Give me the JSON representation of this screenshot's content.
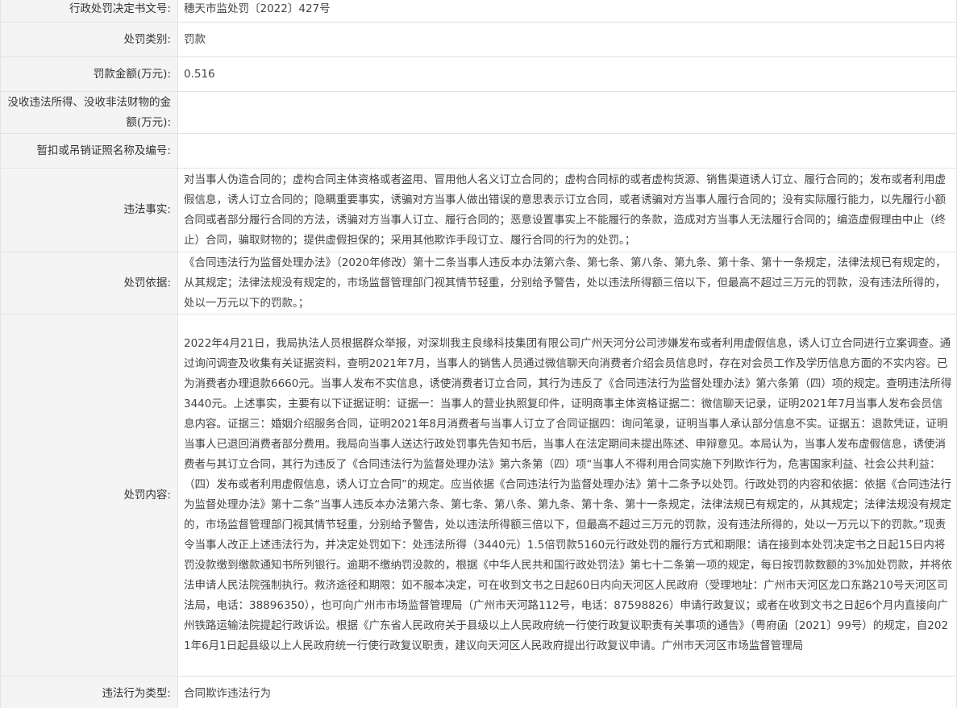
{
  "rows": [
    {
      "label": "行政处罚决定书文号:",
      "value": "穗天市监处罚〔2022〕427号"
    },
    {
      "label": "处罚类别:",
      "value": "罚款"
    },
    {
      "label": "罚款金额(万元):",
      "value": "0.516"
    },
    {
      "label": "没收违法所得、没收非法财物的金额(万元):",
      "value": ""
    },
    {
      "label": "暂扣或吊销证照名称及编号:",
      "value": ""
    },
    {
      "label": "违法事实:",
      "value": "对当事人伪造合同的；虚构合同主体资格或者盗用、冒用他人名义订立合同的；虚构合同标的或者虚构货源、销售渠道诱人订立、履行合同的；发布或者利用虚假信息，诱人订立合同的；隐瞒重要事实，诱骗对方当事人做出错误的意思表示订立合同，或者诱骗对方当事人履行合同的；没有实际履行能力，以先履行小额合同或者部分履行合同的方法，诱骗对方当事人订立、履行合同的；恶意设置事实上不能履行的条款，造成对方当事人无法履行合同的；编造虚假理由中止（终止）合同，骗取财物的；提供虚假担保的；采用其他欺诈手段订立、履行合同的行为的处罚。；"
    },
    {
      "label": "处罚依据:",
      "value": "《合同违法行为监督处理办法》（2020年修改）第十二条当事人违反本办法第六条、第七条、第八条、第九条、第十条、第十一条规定，法律法规已有规定的，从其规定；法律法规没有规定的，市场监督管理部门视其情节轻重，分别给予警告，处以违法所得额三倍以下，但最高不超过三万元的罚款，没有违法所得的，处以一万元以下的罚款。；"
    },
    {
      "label": "处罚内容:",
      "value": "2022年4月21日，我局执法人员根据群众举报，对深圳我主良缘科技集团有限公司广州天河分公司涉嫌发布或者利用虚假信息，诱人订立合同进行立案调查。通过询问调查及收集有关证据资料，查明2021年7月，当事人的销售人员通过微信聊天向消费者介绍会员信息时，存在对会员工作及学历信息方面的不实内容。已为消费者办理退款6660元。当事人发布不实信息，诱使消费者订立合同，其行为违反了《合同违法行为监督处理办法》第六条第（四）项的规定。查明违法所得3440元。上述事实，主要有以下证据证明：证据一：当事人的营业执照复印件，证明商事主体资格证据二：微信聊天记录，证明2021年7月当事人发布会员信息内容。证据三：婚姻介绍服务合同，证明2021年8月消费者与当事人订立了合同证据四：询问笔录，证明当事人承认部分信息不实。证据五：退款凭证，证明当事人已退回消费者部分费用。我局向当事人送达行政处罚事先告知书后，当事人在法定期间未提出陈述、申辩意见。本局认为，当事人发布虚假信息，诱使消费者与其订立合同，其行为违反了《合同违法行为监督处理办法》第六条第（四）项“当事人不得利用合同实施下列欺诈行为，危害国家利益、社会公共利益：（四）发布或者利用虚假信息，诱人订立合同”的规定。应当依据《合同违法行为监督处理办法》第十二条予以处罚。行政处罚的内容和依据：依据《合同违法行为监督处理办法》第十二条“当事人违反本办法第六条、第七条、第八条、第九条、第十条、第十一条规定，法律法规已有规定的，从其规定；法律法规没有规定的，市场监督管理部门视其情节轻重，分别给予警告，处以违法所得额三倍以下，但最高不超过三万元的罚款，没有违法所得的，处以一万元以下的罚款。”现责令当事人改正上述违法行为，并决定处罚如下：处违法所得（3440元）1.5倍罚款5160元行政处罚的履行方式和期限：请在接到本处罚决定书之日起15日内将罚没款缴到缴款通知书所列银行。逾期不缴纳罚没款的，根据《中华人民共和国行政处罚法》第七十二条第一项的规定，每日按罚款数额的3%加处罚款，并将依法申请人民法院强制执行。救济途径和期限：如不服本决定，可在收到文书之日起60日内向天河区人民政府（受理地址：广州市天河区龙口东路210号天河区司法局，电话：38896350），也可向广州市市场监督管理局（广州市天河路112号，电话：87598826）申请行政复议；或者在收到文书之日起6个月内直接向广州铁路运输法院提起行政诉讼。根据《广东省人民政府关于县级以上人民政府统一行使行政复议职责有关事项的通告》（粤府函〔2021〕99号）的规定，自2021年6月1日起县级以上人民政府统一行使行政复议职责，建议向天河区人民政府提出行政复议申请。广州市天河区市场监督管理局"
    },
    {
      "label": "违法行为类型:",
      "value": "合同欺诈违法行为"
    }
  ]
}
